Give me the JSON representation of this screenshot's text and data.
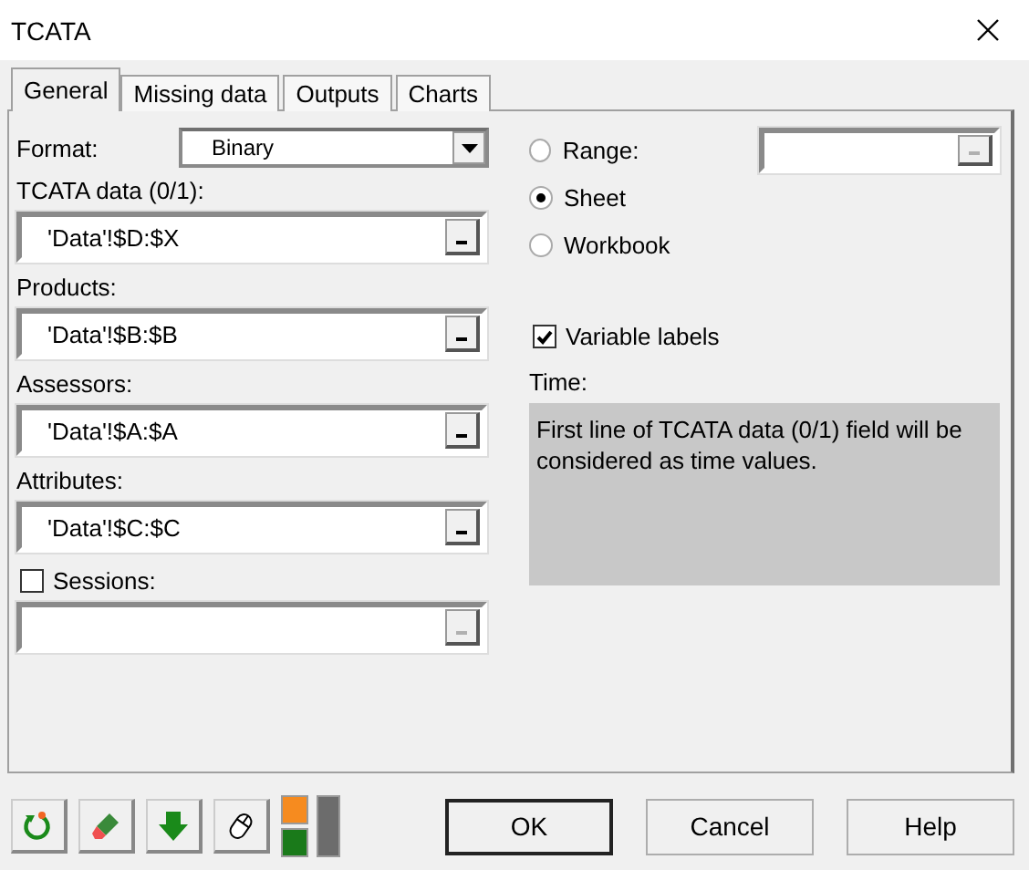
{
  "window": {
    "title": "TCATA"
  },
  "tabs": [
    {
      "label": "General",
      "selected": true
    },
    {
      "label": "Missing data",
      "selected": false
    },
    {
      "label": "Outputs",
      "selected": false
    },
    {
      "label": "Charts",
      "selected": false
    }
  ],
  "format": {
    "label": "Format:",
    "value": "Binary"
  },
  "ranges": [
    {
      "label": "TCATA data (0/1):",
      "value": "'Data'!$D:$X",
      "disabled": false
    },
    {
      "label": "Products:",
      "value": "'Data'!$B:$B",
      "disabled": false
    },
    {
      "label": "Assessors:",
      "value": "'Data'!$A:$A",
      "disabled": false
    },
    {
      "label": "Attributes:",
      "value": "'Data'!$C:$C",
      "disabled": false
    }
  ],
  "sessions": {
    "label": "Sessions:",
    "checked": false,
    "disabled": true
  },
  "output_options": [
    {
      "label": "Range:",
      "selected": false
    },
    {
      "label": "Sheet",
      "selected": true
    },
    {
      "label": "Workbook",
      "selected": false
    }
  ],
  "range_field": {
    "disabled": true
  },
  "variable_labels": {
    "label": "Variable labels",
    "checked": true
  },
  "time": {
    "label": "Time:",
    "note": "First line of TCATA data (0/1) field will be considered as time values."
  },
  "buttons": [
    {
      "label": "OK",
      "default": true
    },
    {
      "label": "Cancel",
      "default": false
    },
    {
      "label": "Help",
      "default": false
    }
  ]
}
